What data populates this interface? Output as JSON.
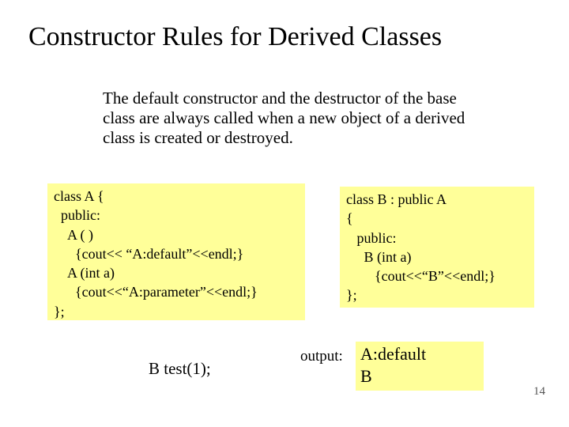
{
  "title": "Constructor Rules for Derived Classes",
  "paragraph": "The default constructor and the destructor of the base class are always called when a new object of a derived class is created or destroyed.",
  "code_a": "class A {\n  public:\n    A ( )\n      {cout<< “A:default”<<endl;}\n    A (int a)\n      {cout<<“A:parameter”<<endl;}\n};",
  "code_b": "class B : public A\n{\n   public:\n     B (int a)\n        {cout<<“B”<<endl;}\n};",
  "call_code": "B test(1);",
  "output_label": "output:",
  "output_text": "A:default\nB",
  "page_number": "14"
}
